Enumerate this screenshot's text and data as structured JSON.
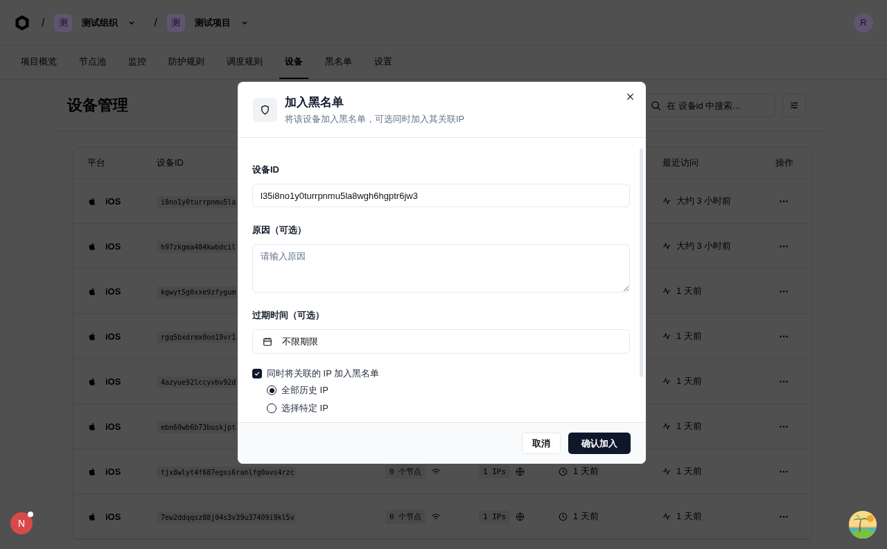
{
  "header": {
    "separator": "/",
    "org": {
      "badge": "测",
      "name": "测试组织"
    },
    "project": {
      "badge": "测",
      "name": "测试项目"
    },
    "user_avatar": "R"
  },
  "tabs": [
    {
      "label": "项目概览",
      "selected": false
    },
    {
      "label": "节点池",
      "selected": false
    },
    {
      "label": "监控",
      "selected": false
    },
    {
      "label": "防护规则",
      "selected": false
    },
    {
      "label": "调度规则",
      "selected": false
    },
    {
      "label": "设备",
      "selected": true
    },
    {
      "label": "黑名单",
      "selected": false
    },
    {
      "label": "设置",
      "selected": false
    }
  ],
  "page": {
    "title": "设备管理",
    "search": {
      "placeholder": "在 设备id 中搜索..."
    }
  },
  "table": {
    "columns": [
      "平台",
      "设备ID",
      "最近访问",
      "操作"
    ],
    "rows": [
      {
        "platform": "iOS",
        "device_id": "i8no1y0turrpnmu5la",
        "last_visit": "大约 3 小时前"
      },
      {
        "platform": "iOS",
        "device_id": "h97zkgma484kwbdcil",
        "last_visit": "大约 3 小时前"
      },
      {
        "platform": "iOS",
        "device_id": "kgwyt5g0xxe9zfygum",
        "last_visit": "1 天前"
      },
      {
        "platform": "iOS",
        "device_id": "rgq5bxdrmx0oo19vr1",
        "last_visit": "1 天前"
      },
      {
        "platform": "iOS",
        "device_id": "4azyue92lccyvbv92d",
        "last_visit": "1 天前"
      },
      {
        "platform": "iOS",
        "device_id": "ebn60wb6b73buskjpt",
        "last_visit": "1 天前"
      },
      {
        "platform": "iOS",
        "device_id": "tjx8wlyt4f687egxs6ranlfg0avs4rzc",
        "nodes": "0 个节点",
        "ips": "1 IPs",
        "first_seen": "1 天前",
        "last_visit": "1 天前"
      },
      {
        "platform": "iOS",
        "device_id": "7ew2ddqqsz88j04s3v39u37409i9kl5v",
        "nodes": "0 个节点",
        "ips": "1 IPs",
        "first_seen": "1 天前",
        "last_visit": "1 天前"
      }
    ]
  },
  "dialog": {
    "title": "加入黑名单",
    "subtitle": "将该设备加入黑名单，可选同时加入其关联IP",
    "fields": [
      {
        "kind": "text",
        "label": "设备ID",
        "value": "l35i8no1y0turrpnmu5la8wgh6hgptr6jw3"
      },
      {
        "kind": "textarea",
        "label": "原因（可选）",
        "placeholder": "请输入原因"
      },
      {
        "kind": "date",
        "label": "过期时间（可选）",
        "value": "不限期限"
      }
    ],
    "include_ips": {
      "label": "同时将关联的 IP 加入黑名单",
      "checked": true
    },
    "ip_options": [
      {
        "label": "全部历史 IP",
        "selected": true
      },
      {
        "label": "选择特定 IP",
        "selected": false
      }
    ],
    "buttons": [
      {
        "kind": "secondary",
        "label": "取消"
      },
      {
        "kind": "primary",
        "label": "确认加入"
      }
    ]
  },
  "floating_badge": {
    "letter": "N"
  }
}
